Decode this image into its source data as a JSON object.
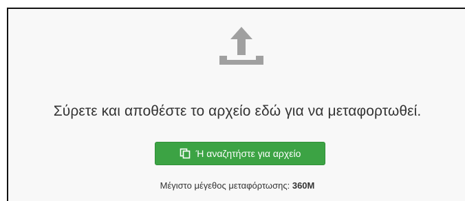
{
  "dropzone": {
    "icon": "upload-tray-icon",
    "drop_text": "Σύρετε και αποθέστε το αρχείο εδώ για να μεταφορτωθεί.",
    "browse_button": {
      "icon": "copy-icon",
      "label": "Ή αναζητήστε για αρχείο"
    },
    "max_size": {
      "label": "Μέγιστο μέγεθος μεταφόρτωσης:",
      "value": "360M"
    }
  },
  "colors": {
    "background": "#f8f8f8",
    "icon_gray": "#a0a0a0",
    "button_green": "#3ca344",
    "text": "#333333"
  }
}
